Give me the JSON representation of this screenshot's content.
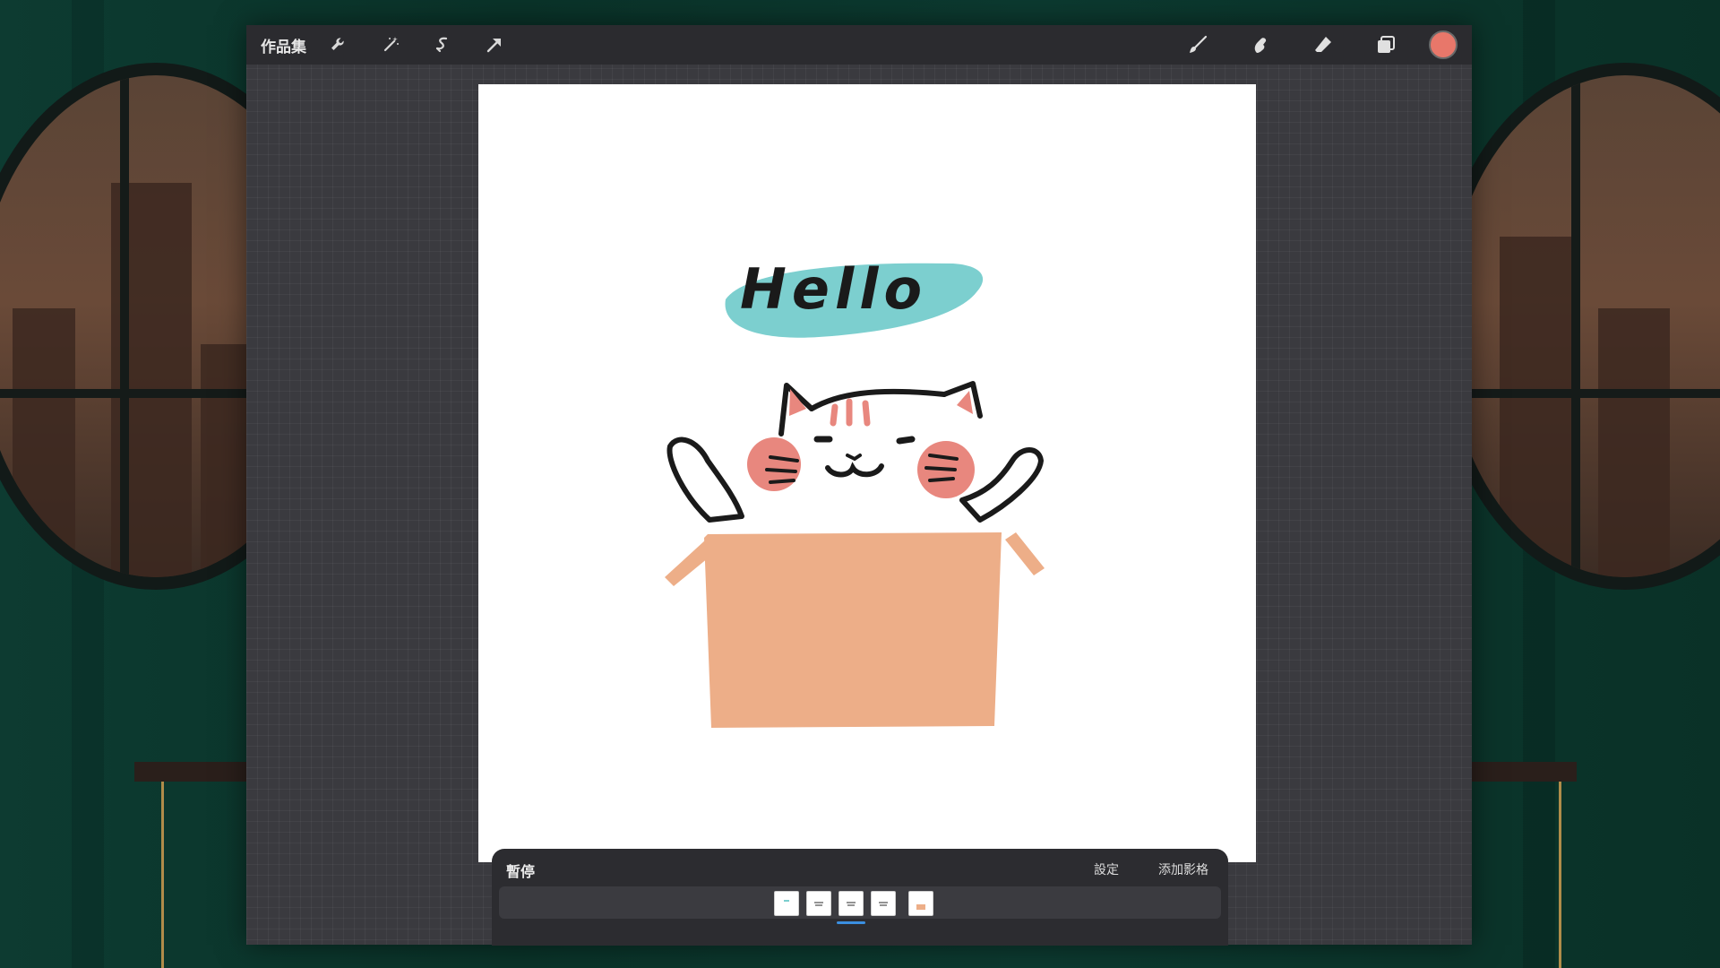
{
  "toolbar": {
    "gallery_label": "作品集",
    "left_tools": [
      {
        "name": "wrench-icon"
      },
      {
        "name": "magic-wand-icon"
      },
      {
        "name": "selection-icon"
      },
      {
        "name": "transform-arrow-icon"
      }
    ],
    "right_tools": [
      {
        "name": "brush-icon"
      },
      {
        "name": "smudge-icon"
      },
      {
        "name": "eraser-icon"
      },
      {
        "name": "layers-icon"
      }
    ],
    "current_color": "#e8776a"
  },
  "canvas": {
    "text": "Hello",
    "colors": {
      "highlight": "#7ccfcf",
      "box": "#edae88",
      "cheeks": "#e8877e",
      "ink": "#1a1a1a"
    }
  },
  "animation": {
    "pause_label": "暫停",
    "settings_label": "設定",
    "add_frame_label": "添加影格",
    "frames": [
      {
        "index": 1
      },
      {
        "index": 2
      },
      {
        "index": 3
      },
      {
        "index": 4
      },
      {
        "index": 5
      }
    ],
    "selected_frame": 3
  },
  "accent_color": "#3b8fe0"
}
